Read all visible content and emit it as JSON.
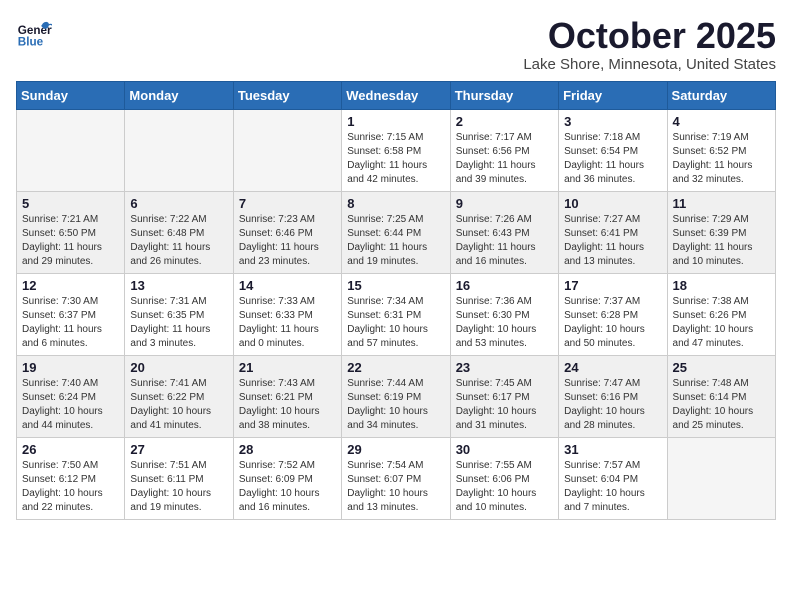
{
  "header": {
    "logo_general": "General",
    "logo_blue": "Blue",
    "month": "October 2025",
    "location": "Lake Shore, Minnesota, United States"
  },
  "weekdays": [
    "Sunday",
    "Monday",
    "Tuesday",
    "Wednesday",
    "Thursday",
    "Friday",
    "Saturday"
  ],
  "weeks": [
    [
      {
        "day": "",
        "info": ""
      },
      {
        "day": "",
        "info": ""
      },
      {
        "day": "",
        "info": ""
      },
      {
        "day": "1",
        "info": "Sunrise: 7:15 AM\nSunset: 6:58 PM\nDaylight: 11 hours\nand 42 minutes."
      },
      {
        "day": "2",
        "info": "Sunrise: 7:17 AM\nSunset: 6:56 PM\nDaylight: 11 hours\nand 39 minutes."
      },
      {
        "day": "3",
        "info": "Sunrise: 7:18 AM\nSunset: 6:54 PM\nDaylight: 11 hours\nand 36 minutes."
      },
      {
        "day": "4",
        "info": "Sunrise: 7:19 AM\nSunset: 6:52 PM\nDaylight: 11 hours\nand 32 minutes."
      }
    ],
    [
      {
        "day": "5",
        "info": "Sunrise: 7:21 AM\nSunset: 6:50 PM\nDaylight: 11 hours\nand 29 minutes."
      },
      {
        "day": "6",
        "info": "Sunrise: 7:22 AM\nSunset: 6:48 PM\nDaylight: 11 hours\nand 26 minutes."
      },
      {
        "day": "7",
        "info": "Sunrise: 7:23 AM\nSunset: 6:46 PM\nDaylight: 11 hours\nand 23 minutes."
      },
      {
        "day": "8",
        "info": "Sunrise: 7:25 AM\nSunset: 6:44 PM\nDaylight: 11 hours\nand 19 minutes."
      },
      {
        "day": "9",
        "info": "Sunrise: 7:26 AM\nSunset: 6:43 PM\nDaylight: 11 hours\nand 16 minutes."
      },
      {
        "day": "10",
        "info": "Sunrise: 7:27 AM\nSunset: 6:41 PM\nDaylight: 11 hours\nand 13 minutes."
      },
      {
        "day": "11",
        "info": "Sunrise: 7:29 AM\nSunset: 6:39 PM\nDaylight: 11 hours\nand 10 minutes."
      }
    ],
    [
      {
        "day": "12",
        "info": "Sunrise: 7:30 AM\nSunset: 6:37 PM\nDaylight: 11 hours\nand 6 minutes."
      },
      {
        "day": "13",
        "info": "Sunrise: 7:31 AM\nSunset: 6:35 PM\nDaylight: 11 hours\nand 3 minutes."
      },
      {
        "day": "14",
        "info": "Sunrise: 7:33 AM\nSunset: 6:33 PM\nDaylight: 11 hours\nand 0 minutes."
      },
      {
        "day": "15",
        "info": "Sunrise: 7:34 AM\nSunset: 6:31 PM\nDaylight: 10 hours\nand 57 minutes."
      },
      {
        "day": "16",
        "info": "Sunrise: 7:36 AM\nSunset: 6:30 PM\nDaylight: 10 hours\nand 53 minutes."
      },
      {
        "day": "17",
        "info": "Sunrise: 7:37 AM\nSunset: 6:28 PM\nDaylight: 10 hours\nand 50 minutes."
      },
      {
        "day": "18",
        "info": "Sunrise: 7:38 AM\nSunset: 6:26 PM\nDaylight: 10 hours\nand 47 minutes."
      }
    ],
    [
      {
        "day": "19",
        "info": "Sunrise: 7:40 AM\nSunset: 6:24 PM\nDaylight: 10 hours\nand 44 minutes."
      },
      {
        "day": "20",
        "info": "Sunrise: 7:41 AM\nSunset: 6:22 PM\nDaylight: 10 hours\nand 41 minutes."
      },
      {
        "day": "21",
        "info": "Sunrise: 7:43 AM\nSunset: 6:21 PM\nDaylight: 10 hours\nand 38 minutes."
      },
      {
        "day": "22",
        "info": "Sunrise: 7:44 AM\nSunset: 6:19 PM\nDaylight: 10 hours\nand 34 minutes."
      },
      {
        "day": "23",
        "info": "Sunrise: 7:45 AM\nSunset: 6:17 PM\nDaylight: 10 hours\nand 31 minutes."
      },
      {
        "day": "24",
        "info": "Sunrise: 7:47 AM\nSunset: 6:16 PM\nDaylight: 10 hours\nand 28 minutes."
      },
      {
        "day": "25",
        "info": "Sunrise: 7:48 AM\nSunset: 6:14 PM\nDaylight: 10 hours\nand 25 minutes."
      }
    ],
    [
      {
        "day": "26",
        "info": "Sunrise: 7:50 AM\nSunset: 6:12 PM\nDaylight: 10 hours\nand 22 minutes."
      },
      {
        "day": "27",
        "info": "Sunrise: 7:51 AM\nSunset: 6:11 PM\nDaylight: 10 hours\nand 19 minutes."
      },
      {
        "day": "28",
        "info": "Sunrise: 7:52 AM\nSunset: 6:09 PM\nDaylight: 10 hours\nand 16 minutes."
      },
      {
        "day": "29",
        "info": "Sunrise: 7:54 AM\nSunset: 6:07 PM\nDaylight: 10 hours\nand 13 minutes."
      },
      {
        "day": "30",
        "info": "Sunrise: 7:55 AM\nSunset: 6:06 PM\nDaylight: 10 hours\nand 10 minutes."
      },
      {
        "day": "31",
        "info": "Sunrise: 7:57 AM\nSunset: 6:04 PM\nDaylight: 10 hours\nand 7 minutes."
      },
      {
        "day": "",
        "info": ""
      }
    ]
  ]
}
